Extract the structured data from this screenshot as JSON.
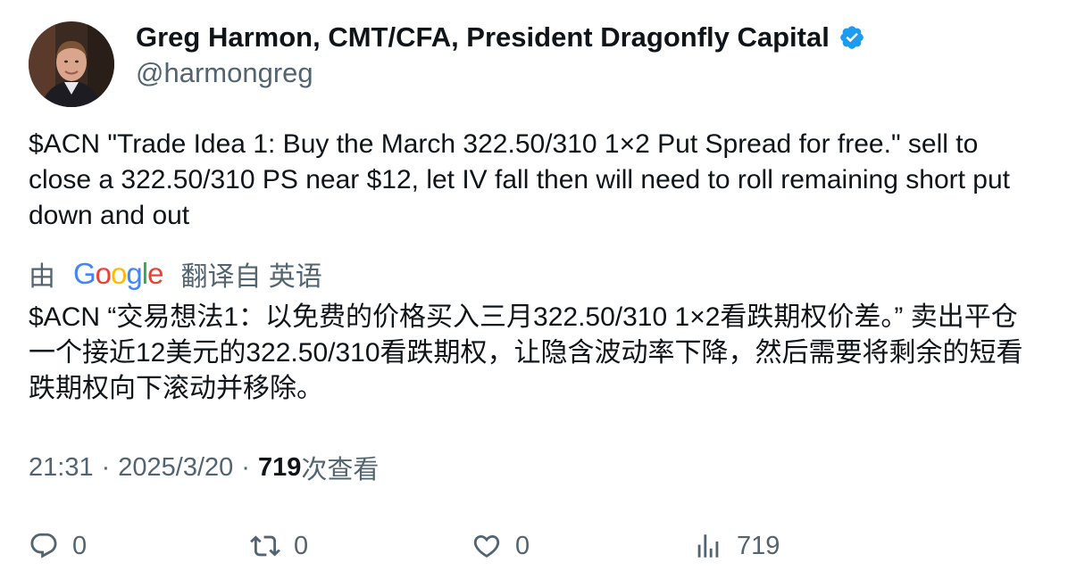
{
  "author": {
    "display_name": "Greg Harmon, CMT/CFA, President Dragonfly Capital",
    "handle": "@harmongreg",
    "verified": true
  },
  "tweet": {
    "text": "$ACN \"Trade Idea 1: Buy the March 322.50/310 1×2 Put Spread for free.\" sell to close a 322.50/310 PS near $12, let IV fall then will need to roll remaining short put down and out"
  },
  "translation": {
    "by_label": "由",
    "provider": "Google",
    "from_label": "翻译自 英语",
    "text": "$ACN “交易想法1：以免费的价格买入三月322.50/310 1×2看跌期权价差。” 卖出平仓一个接近12美元的322.50/310看跌期权，让隐含波动率下降，然后需要将剩余的短看跌期权向下滚动并移除。"
  },
  "meta": {
    "time": "21:31",
    "separator": "·",
    "date": "2025/3/20",
    "views_count": "719",
    "views_label": "次查看"
  },
  "actions": {
    "reply_count": "0",
    "retweet_count": "0",
    "like_count": "0",
    "views_count": "719"
  },
  "colors": {
    "text_primary": "#0f1419",
    "text_secondary": "#536471",
    "verified_blue": "#1d9bf0"
  },
  "icons": {
    "verified": "verified-badge-icon",
    "reply": "reply-icon",
    "retweet": "retweet-icon",
    "like": "heart-icon",
    "views": "views-chart-icon"
  }
}
